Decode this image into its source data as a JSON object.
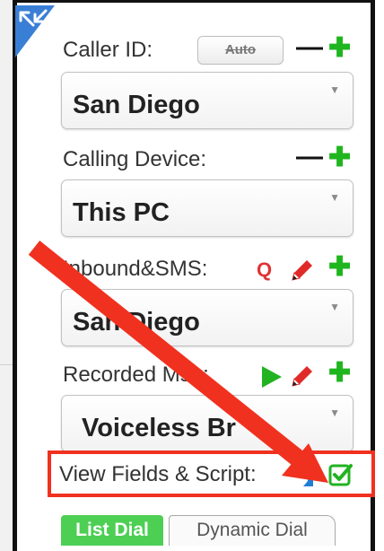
{
  "caller_id": {
    "label": "Caller ID:",
    "auto_label": "Auto",
    "value": "San Diego"
  },
  "calling_device": {
    "label": "Calling Device:",
    "value": "This PC"
  },
  "inbound_sms": {
    "label": "Inbound&SMS:",
    "q_label": "Q",
    "value": "San Diego"
  },
  "recorded_msg": {
    "label": "Recorded Msg:",
    "value": "Voiceless Br"
  },
  "view_fields": {
    "label": "View Fields & Script:",
    "checked": true
  },
  "tabs": [
    {
      "label": "List Dial",
      "active": true
    },
    {
      "label": "Dynamic Dial",
      "active": false
    }
  ],
  "colors": {
    "accent_green": "#1fb51f",
    "tab_green": "#4dcf54",
    "annotation_red": "#f0311f",
    "icon_red": "#e03333",
    "corner_blue": "#3a7fd6"
  }
}
